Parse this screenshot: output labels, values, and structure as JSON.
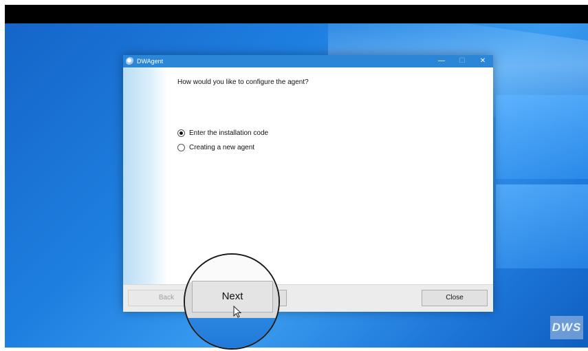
{
  "window": {
    "title": "DWAgent",
    "controls": {
      "minimize": "—",
      "maximize": "☐",
      "close": "✕"
    }
  },
  "content": {
    "question": "How would you like to configure the agent?",
    "options": [
      {
        "label": "Enter the installation code",
        "selected": true
      },
      {
        "label": "Creating a new agent",
        "selected": false
      }
    ]
  },
  "buttons": {
    "back": "Back",
    "next": "Next",
    "close": "Close"
  },
  "watermark": {
    "text": "DWS"
  },
  "icons": {
    "app": "dwagent-app-icon",
    "cursor": "mouse-pointer-icon"
  }
}
